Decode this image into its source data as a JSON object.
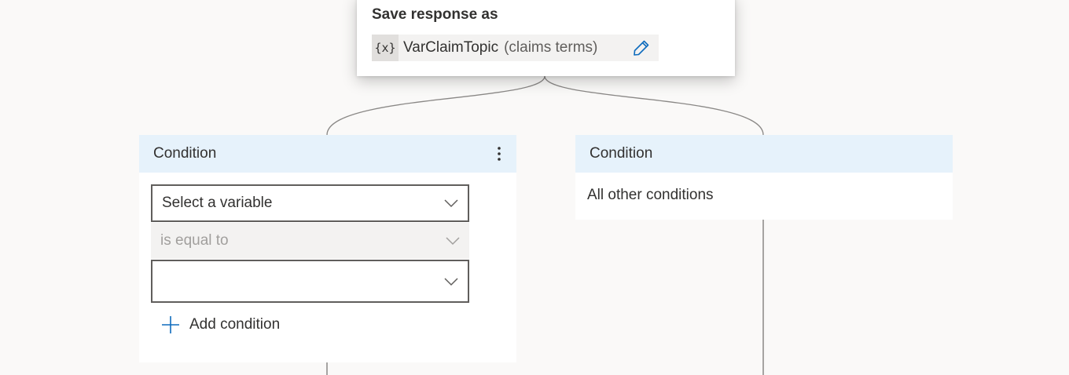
{
  "save_card": {
    "title": "Save response as",
    "variable": {
      "icon": "{x}",
      "name": "VarClaimTopic",
      "description": "(claims terms)"
    }
  },
  "branches": [
    {
      "header": "Condition",
      "variable_select": {
        "value": "Select a variable"
      },
      "operator_select": {
        "value": "is equal to"
      },
      "value_select": {
        "value": ""
      },
      "add_condition_label": "Add condition"
    },
    {
      "header": "Condition",
      "body_text": "All other conditions"
    }
  ],
  "colors": {
    "canvas": "#faf9f8",
    "header_bg": "#e6f2fb",
    "accent": "#0f6cbd",
    "connector": "#8a8886"
  }
}
